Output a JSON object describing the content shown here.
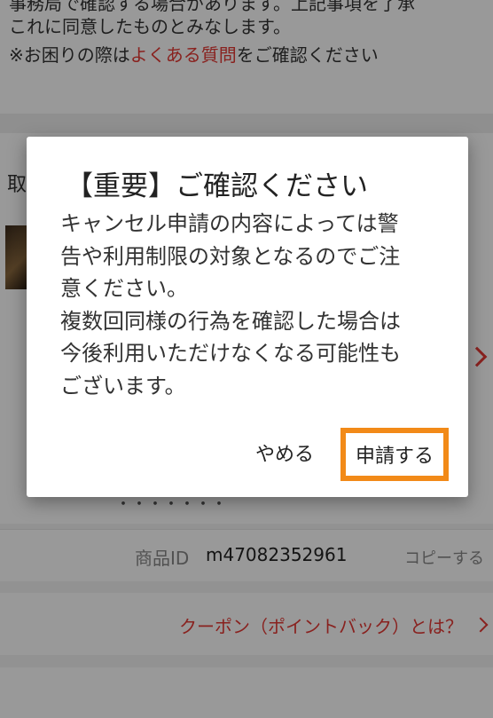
{
  "background": {
    "notice": {
      "line1": "事務局で確認する場合があります。上記事項を了承",
      "line2": "これに同意したものとみなします。",
      "line3_prefix": "※お困りの際は",
      "line3_link": "よくある質問",
      "line3_suffix": "をご確認ください"
    },
    "card": {
      "cut_heading": "取",
      "hidden_text": "・・・・・・・"
    },
    "product_id": {
      "label": "商品ID",
      "value": "m47082352961",
      "copy_label": "コピーする"
    },
    "coupon_link": "クーポン（ポイントバック）とは？"
  },
  "dialog": {
    "title": "【重要】ご確認ください",
    "body_lines": [
      "キャンセル申請の内容によっては警",
      "告や利用制限の対象となるのでご注",
      "意ください。",
      "複数回同様の行為を確認した場合は",
      "今後利用いただけなくなる可能性も",
      "ございます。"
    ],
    "cancel_label": "やめる",
    "submit_label": "申請する"
  },
  "colors": {
    "accent_red": "#e53935",
    "highlight_orange": "#f28a18"
  }
}
